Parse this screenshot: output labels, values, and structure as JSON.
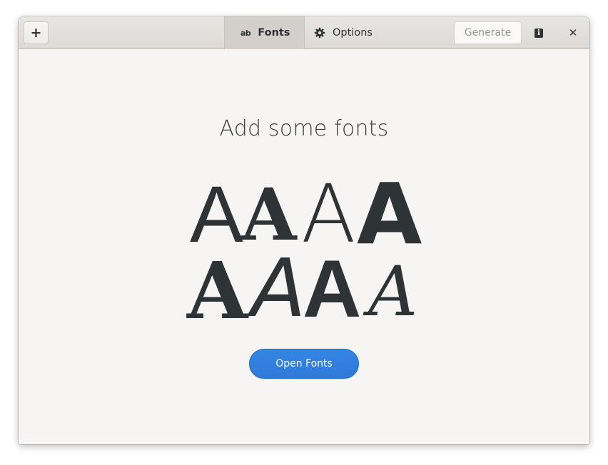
{
  "header": {
    "add_label": "+",
    "tabs": [
      {
        "label": "Fonts",
        "icon": "ab-icon",
        "icon_text": "ab",
        "active": true
      },
      {
        "label": "Options",
        "icon": "gear-icon",
        "active": false
      }
    ],
    "generate_label": "Generate",
    "info_icon_text": "i",
    "close_label": "✕"
  },
  "main": {
    "title": "Add some fonts",
    "sample_glyphs": [
      "A",
      "A",
      "A",
      "A",
      "A",
      "A",
      "A",
      "A"
    ],
    "open_button_label": "Open Fonts"
  },
  "colors": {
    "accent": "#3584e4",
    "text": "#2e3436",
    "window_bg": "#f6f5f4",
    "active_tab_bg": "#d3cfcb"
  }
}
